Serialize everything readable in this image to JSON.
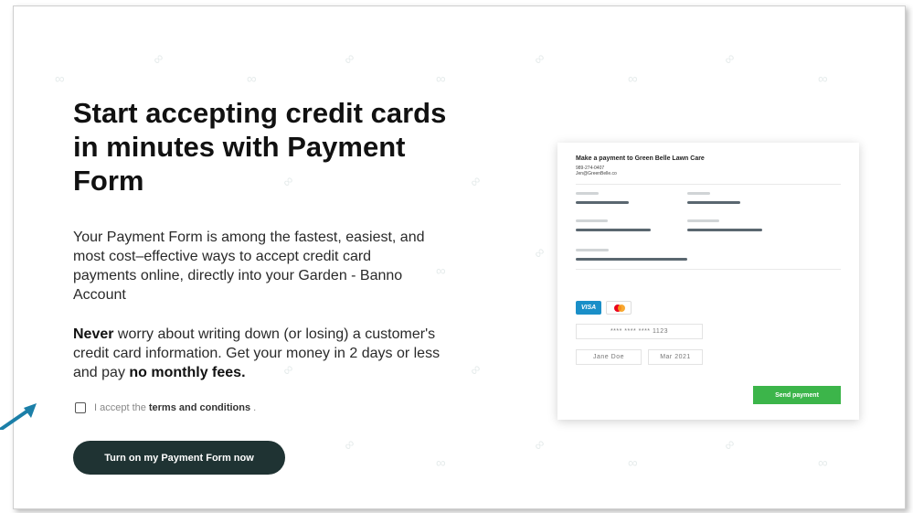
{
  "hero": {
    "headline": "Start accepting credit cards in minutes with Payment Form",
    "intro": "Your Payment Form is among the fastest, easiest, and most cost–effective ways to accept credit card payments online, directly into your Garden - Banno Account",
    "never_bold": "Never",
    "never_text": " worry about writing down (or losing) a customer's credit card information. Get your money in 2 days or less and pay ",
    "no_fees_bold": "no monthly fees.",
    "terms_prefix": "I accept the",
    "terms_link": "terms and conditions",
    "terms_suffix": ".",
    "cta_label": "Turn on my Payment Form now"
  },
  "payment_preview": {
    "title": "Make a payment to Green Belle Lawn Care",
    "phone": "989-274-0407",
    "email": "Jen@GreenBelle.co",
    "visa_label": "VISA",
    "card_number": "**** **** **** 1123",
    "name": "Jane Doe",
    "expiry": "Mar 2021",
    "send_label": "Send payment"
  },
  "colors": {
    "cta_bg": "#1f3333",
    "send_btn": "#3cb54a",
    "visa": "#1a8fc8",
    "arrow": "#1b7fa8"
  },
  "icons": {
    "background_pattern": "link-icon",
    "checkbox": "checkbox-unchecked-icon",
    "mastercard": "mastercard-icon",
    "pointer": "arrow-pointer-icon"
  }
}
